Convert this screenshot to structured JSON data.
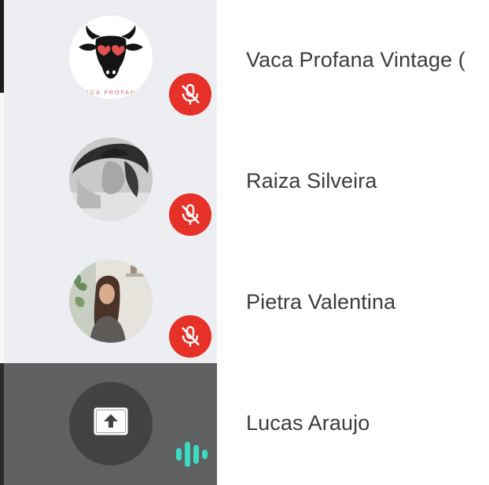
{
  "participants": [
    {
      "name": "Vaca Profana Vintage (",
      "avatar_icon": "cow-logo-avatar-icon",
      "avatar_caption": "VACA PROFANA",
      "mic_status": "muted",
      "mic_icon": "mic-off-icon"
    },
    {
      "name": "Raiza Silveira",
      "avatar_icon": "person-photo-avatar-icon",
      "mic_status": "muted",
      "mic_icon": "mic-off-icon"
    },
    {
      "name": "Pietra Valentina",
      "avatar_icon": "person-photo-avatar-icon",
      "mic_status": "muted",
      "mic_icon": "mic-off-icon"
    },
    {
      "name": "Lucas Araujo",
      "avatar_icon": "screen-share-icon",
      "mic_status": "speaking",
      "mic_icon": "audio-level-icon"
    }
  ],
  "colors": {
    "tile_background": "#eceef1",
    "active_tile_background": "#5e6062",
    "share_circle": "#404244",
    "mute_badge": "#e53127",
    "speaking_indicator": "#3ddbc1",
    "name_text": "#3a3c3f"
  }
}
